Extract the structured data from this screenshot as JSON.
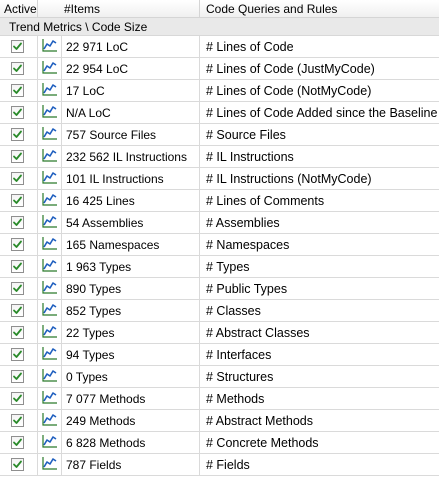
{
  "columns": {
    "active": "Active",
    "items": "#Items",
    "rules": "Code Queries and Rules"
  },
  "group": {
    "title": "Trend Metrics \\ Code Size"
  },
  "icons": {
    "checkbox": "checkbox-checked-icon",
    "trend": "trend-chart-icon"
  },
  "colors": {
    "check_mark": "#2a8a2a",
    "trend_line": "#1f5fbf",
    "trend_axis": "#2a7a2a"
  },
  "rows": [
    {
      "items": "22 971 LoC",
      "rule": "# Lines of Code",
      "active": true
    },
    {
      "items": "22 954 LoC",
      "rule": "# Lines of Code (JustMyCode)",
      "active": true
    },
    {
      "items": "17 LoC",
      "rule": "# Lines of Code (NotMyCode)",
      "active": true
    },
    {
      "items": "N/A LoC",
      "rule": "# Lines of Code Added since the Baseline",
      "active": true
    },
    {
      "items": "757 Source Files",
      "rule": "# Source Files",
      "active": true
    },
    {
      "items": "232 562 IL Instructions",
      "rule": "# IL Instructions",
      "active": true
    },
    {
      "items": "101 IL Instructions",
      "rule": "# IL Instructions (NotMyCode)",
      "active": true
    },
    {
      "items": "16 425 Lines",
      "rule": "# Lines of Comments",
      "active": true
    },
    {
      "items": "54 Assemblies",
      "rule": "# Assemblies",
      "active": true
    },
    {
      "items": "165 Namespaces",
      "rule": "# Namespaces",
      "active": true
    },
    {
      "items": "1 963 Types",
      "rule": "# Types",
      "active": true
    },
    {
      "items": "890 Types",
      "rule": "# Public Types",
      "active": true
    },
    {
      "items": "852 Types",
      "rule": "# Classes",
      "active": true
    },
    {
      "items": "22 Types",
      "rule": "# Abstract Classes",
      "active": true
    },
    {
      "items": "94 Types",
      "rule": "# Interfaces",
      "active": true
    },
    {
      "items": "0 Types",
      "rule": "# Structures",
      "active": true
    },
    {
      "items": "7 077 Methods",
      "rule": "# Methods",
      "active": true
    },
    {
      "items": "249 Methods",
      "rule": "# Abstract Methods",
      "active": true
    },
    {
      "items": "6 828 Methods",
      "rule": "# Concrete Methods",
      "active": true
    },
    {
      "items": "787 Fields",
      "rule": "# Fields",
      "active": true
    }
  ]
}
